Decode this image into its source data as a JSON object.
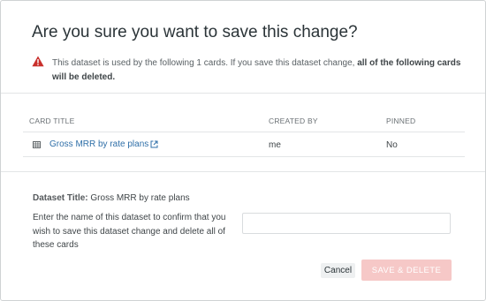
{
  "dialog": {
    "title": "Are you sure you want to save this change?",
    "warning": {
      "text_prefix": "This dataset is used by the following 1 cards. If you save this dataset change, ",
      "text_bold": "all of the following cards will be deleted."
    }
  },
  "table": {
    "headers": {
      "card_title": "CARD TITLE",
      "created_by": "CREATED BY",
      "pinned": "PINNED"
    },
    "rows": [
      {
        "card_title": "Gross MRR by rate plans",
        "created_by": "me",
        "pinned": "No"
      }
    ]
  },
  "form": {
    "dataset_title_label": "Dataset Title:",
    "dataset_title_value": " Gross MRR by rate plans",
    "confirm_label": "Enter the name of this dataset to confirm that you wish to save this dataset change and delete all of these cards",
    "confirm_value": "",
    "confirm_placeholder": ""
  },
  "actions": {
    "cancel_label": "Cancel",
    "save_label": "SAVE & DELETE"
  },
  "icons": {
    "warning": "warning-triangle-icon",
    "card": "grid-icon",
    "external_link": "external-link-icon"
  },
  "colors": {
    "warning_red": "#c9302c",
    "link_blue": "#2f6fa8",
    "save_disabled": "#f6c8c7"
  }
}
